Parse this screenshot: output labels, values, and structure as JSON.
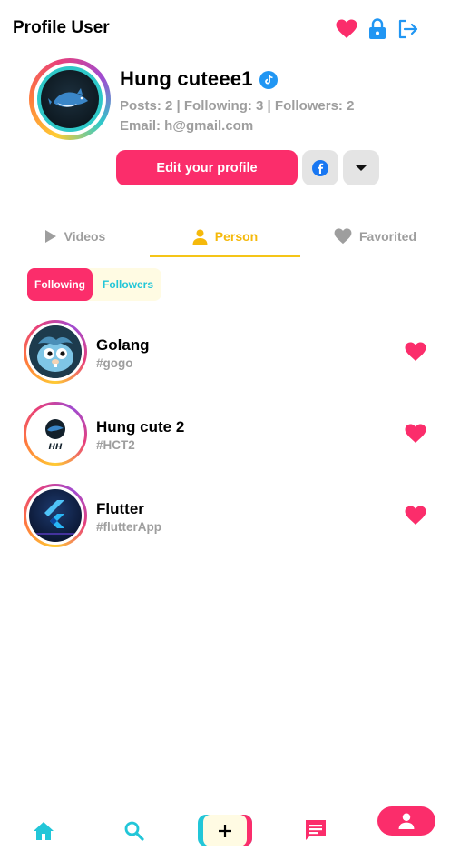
{
  "header": {
    "title": "Profile User"
  },
  "profile": {
    "name": "Hung cuteee1",
    "stats": "Posts: 2 | Following: 3 | Followers: 2",
    "email": "Email: h@gmail.com",
    "edit_label": "Edit your profile"
  },
  "tabs": [
    {
      "label": "Videos",
      "icon": "play-icon"
    },
    {
      "label": "Person",
      "icon": "person-icon"
    },
    {
      "label": "Favorited",
      "icon": "heart-icon"
    }
  ],
  "segment": {
    "following": "Following",
    "followers": "Followers"
  },
  "users": [
    {
      "name": "Golang",
      "tag": "#gogo"
    },
    {
      "name": "Hung cute 2",
      "tag": "#HCT2"
    },
    {
      "name": "Flutter",
      "tag": "#flutterApp"
    }
  ],
  "colors": {
    "accent": "#fb2d6b",
    "cyan": "#22c6d8",
    "yellow": "#f5c518",
    "blue": "#2196f3",
    "gray": "#9e9e9e"
  }
}
